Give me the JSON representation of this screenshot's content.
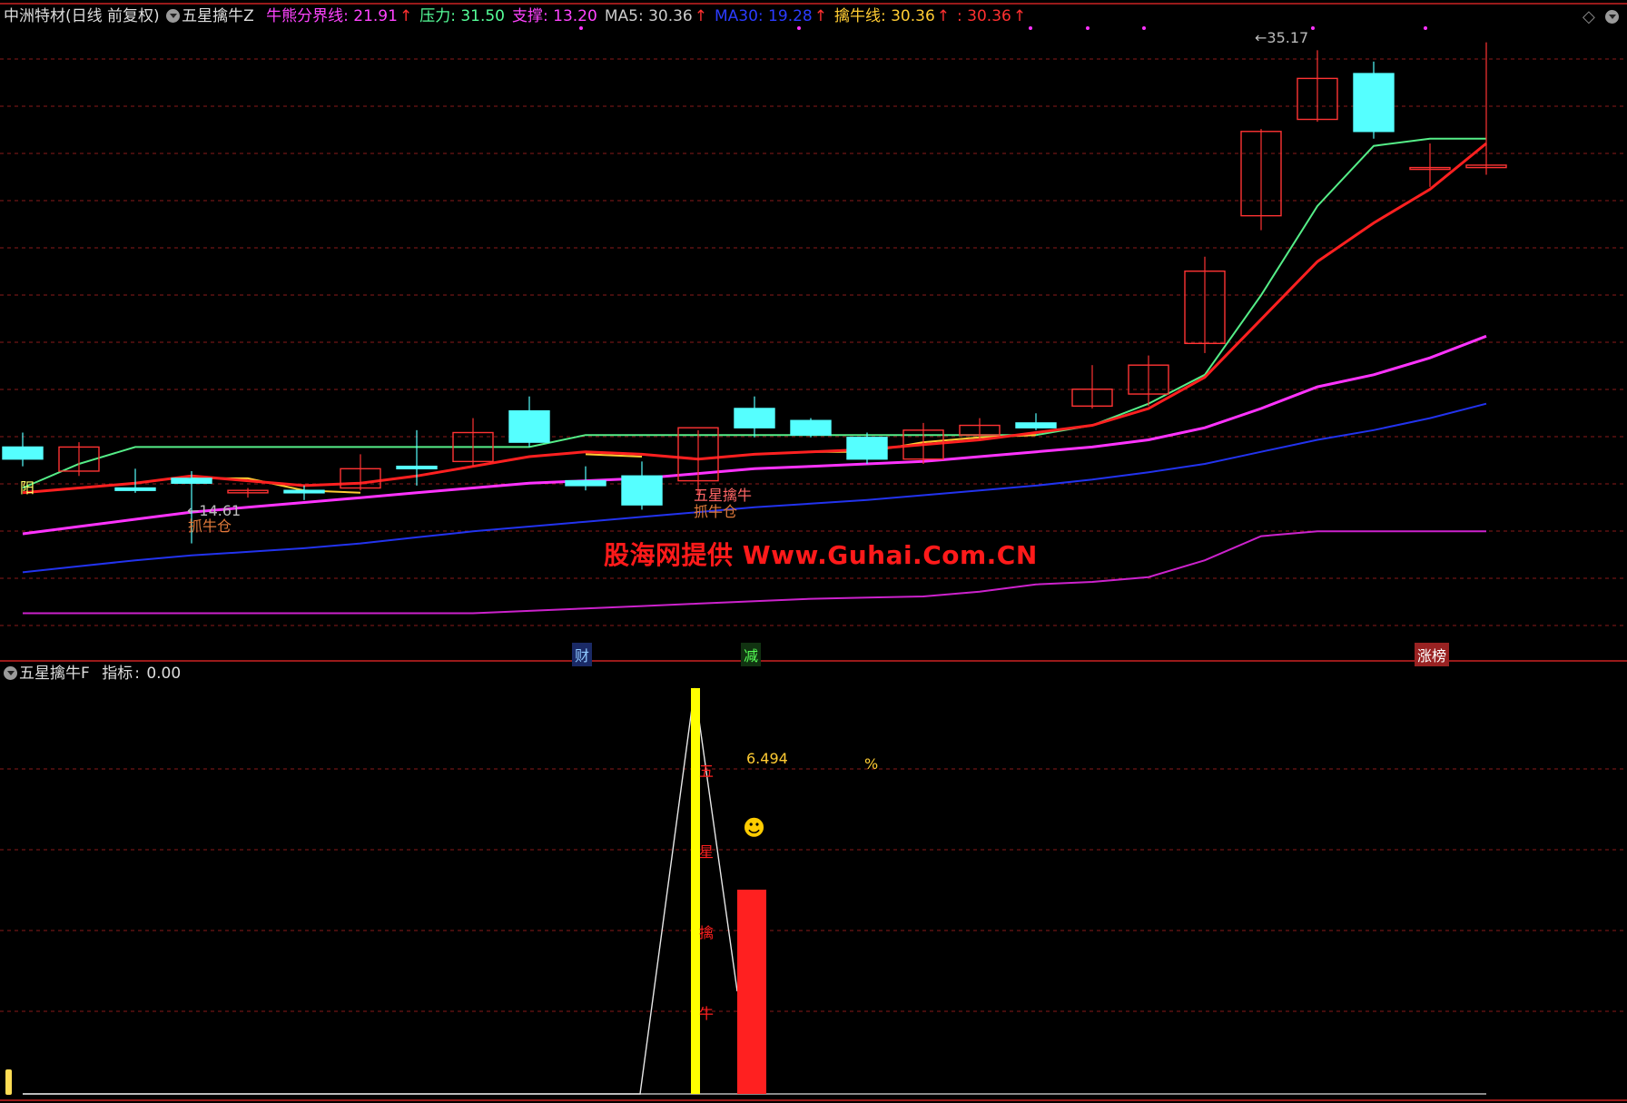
{
  "header": {
    "stock": "中洲特材(日线 前复权)",
    "indicator": "五星擒牛Z",
    "items": [
      {
        "label": "牛熊分界线",
        "value": "21.91",
        "color": "#ff44ff",
        "arrow": true
      },
      {
        "label": "压力",
        "value": "31.50",
        "color": "#55ff99",
        "arrow": false
      },
      {
        "label": "支撑",
        "value": "13.20",
        "color": "#ff44ff",
        "arrow": false
      },
      {
        "label": "MA5",
        "value": "30.36",
        "color": "#cccccc",
        "arrow": true
      },
      {
        "label": "MA30",
        "value": "19.28",
        "color": "#2b3cff",
        "arrow": true
      },
      {
        "label": "擒牛线",
        "value": "30.36",
        "color": "#ffcc33",
        "arrow": true
      },
      {
        "label": "",
        "value": "30.36",
        "color": "#ff3030",
        "arrow": true
      }
    ]
  },
  "sub_header": {
    "indicator": "五星擒牛F",
    "label": "指标",
    "value": "0.00"
  },
  "watermark": "股海网提供 Www.Guhai.Com.CN",
  "bottom_tags": [
    {
      "text": "财",
      "color": "#8fc8ff",
      "bg": "#1a2a66"
    },
    {
      "text": "减",
      "color": "#55ff55",
      "bg": "#113311"
    },
    {
      "text": "涨榜",
      "color": "#ffffff",
      "bg": "#992222"
    }
  ],
  "annotations": {
    "low": "←14.61",
    "high": "←35.17",
    "yang": "阳",
    "grab1": "抓牛仓",
    "grab2": "抓牛仓",
    "wuxing": "五星擒牛",
    "pct_value": "6.494",
    "pct_sign": "%",
    "vert_chars": [
      "五",
      "星",
      "擒",
      "牛"
    ],
    "smiley": "☻"
  },
  "colors": {
    "up": "#ff3333",
    "down": "#55ffff",
    "grid": "#8a1a1a",
    "divider": "#cc2222",
    "green": "#55ee88",
    "red": "#ff2020",
    "magenta": "#ff33ff",
    "blue": "#2233ee",
    "purple": "#cc22cc",
    "yellow": "#ffff00",
    "amber": "#ffcc33"
  },
  "chart_data": [
    {
      "type": "candlestick",
      "price_range": [
        10.2,
        36.2
      ],
      "ohlc": [
        {
          "o": 18.7,
          "h": 19.3,
          "c": 18.2,
          "l": 17.9
        },
        {
          "o": 17.7,
          "h": 18.9,
          "c": 18.7,
          "l": 17.5
        },
        {
          "o": 17.0,
          "h": 17.8,
          "c": 16.9,
          "l": 16.8
        },
        {
          "o": 17.4,
          "h": 17.7,
          "c": 17.2,
          "l": 14.7
        },
        {
          "o": 16.8,
          "h": 17.0,
          "c": 16.9,
          "l": 16.6
        },
        {
          "o": 16.9,
          "h": 17.1,
          "c": 16.8,
          "l": 16.5
        },
        {
          "o": 17.0,
          "h": 18.4,
          "c": 17.8,
          "l": 16.9
        },
        {
          "o": 17.9,
          "h": 19.4,
          "c": 17.8,
          "l": 17.1
        },
        {
          "o": 18.1,
          "h": 19.9,
          "c": 19.3,
          "l": 17.9
        },
        {
          "o": 20.2,
          "h": 20.8,
          "c": 18.9,
          "l": 18.7
        },
        {
          "o": 17.3,
          "h": 17.9,
          "c": 17.1,
          "l": 16.9
        },
        {
          "o": 17.5,
          "h": 18.1,
          "c": 16.3,
          "l": 16.1
        },
        {
          "o": 17.3,
          "h": 19.4,
          "c": 19.5,
          "l": 16.7
        },
        {
          "o": 20.3,
          "h": 20.8,
          "c": 19.5,
          "l": 19.1
        },
        {
          "o": 19.8,
          "h": 19.9,
          "c": 19.2,
          "l": 19.1
        },
        {
          "o": 19.1,
          "h": 19.3,
          "c": 18.2,
          "l": 18.0
        },
        {
          "o": 18.2,
          "h": 19.7,
          "c": 19.4,
          "l": 18.0
        },
        {
          "o": 19.2,
          "h": 19.9,
          "c": 19.6,
          "l": 19.0
        },
        {
          "o": 19.7,
          "h": 20.1,
          "c": 19.5,
          "l": 19.4
        },
        {
          "o": 20.4,
          "h": 22.1,
          "c": 21.1,
          "l": 20.3
        },
        {
          "o": 20.9,
          "h": 22.5,
          "c": 22.1,
          "l": 20.4
        },
        {
          "o": 23.0,
          "h": 26.6,
          "c": 26.0,
          "l": 22.6
        },
        {
          "o": 28.3,
          "h": 31.9,
          "c": 31.8,
          "l": 27.7
        },
        {
          "o": 32.3,
          "h": 35.17,
          "c": 34.0,
          "l": 32.2
        },
        {
          "o": 34.2,
          "h": 34.7,
          "c": 31.8,
          "l": 31.5
        },
        {
          "o": 30.3,
          "h": 31.3,
          "c": 30.3,
          "l": 29.5
        },
        {
          "o": 30.3,
          "h": 35.5,
          "c": 30.4,
          "l": 30.0
        }
      ],
      "lines": [
        {
          "name": "压力",
          "color": "green",
          "values": [
            17.0,
            18.0,
            18.7,
            18.7,
            18.7,
            18.7,
            18.7,
            18.7,
            18.7,
            18.7,
            19.2,
            19.2,
            19.2,
            19.2,
            19.2,
            19.2,
            19.2,
            19.2,
            19.2,
            19.6,
            20.5,
            21.7,
            25.0,
            28.7,
            31.2,
            31.5,
            31.5
          ]
        },
        {
          "name": "擒牛线",
          "color": "amber",
          "values": [
            null,
            null,
            null,
            17.4,
            17.4,
            16.9,
            16.8,
            null,
            null,
            null,
            18.4,
            18.3,
            null,
            null,
            18.5,
            18.5,
            18.9,
            19.1,
            19.2,
            null,
            null,
            null,
            null,
            null,
            null,
            null,
            null
          ]
        },
        {
          "name": "MA5",
          "color": "red",
          "values": [
            16.8,
            17.0,
            17.2,
            17.5,
            17.3,
            17.1,
            17.2,
            17.5,
            17.9,
            18.3,
            18.5,
            18.4,
            18.2,
            18.4,
            18.5,
            18.6,
            18.8,
            19.0,
            19.3,
            19.6,
            20.3,
            21.6,
            24.0,
            26.4,
            28.0,
            29.4,
            31.3
          ]
        },
        {
          "name": "牛熊分界线",
          "color": "magenta",
          "values": [
            15.1,
            15.4,
            15.7,
            16.0,
            16.2,
            16.4,
            16.6,
            16.8,
            17.0,
            17.2,
            17.3,
            17.4,
            17.6,
            17.8,
            17.9,
            18.0,
            18.1,
            18.3,
            18.5,
            18.7,
            19.0,
            19.5,
            20.3,
            21.2,
            21.7,
            22.4,
            23.3
          ]
        },
        {
          "name": "MA30",
          "color": "blue",
          "values": [
            13.5,
            13.75,
            14.0,
            14.2,
            14.35,
            14.5,
            14.7,
            14.95,
            15.2,
            15.4,
            15.6,
            15.8,
            16.0,
            16.2,
            16.35,
            16.5,
            16.7,
            16.9,
            17.1,
            17.35,
            17.65,
            18.0,
            18.5,
            19.0,
            19.4,
            19.9,
            20.5
          ]
        },
        {
          "name": "支撑",
          "color": "purple",
          "values": [
            11.8,
            11.8,
            11.8,
            11.8,
            11.8,
            11.8,
            11.8,
            11.8,
            11.8,
            11.9,
            12.0,
            12.1,
            12.2,
            12.3,
            12.4,
            12.45,
            12.5,
            12.7,
            13.0,
            13.1,
            13.3,
            14.0,
            15.0,
            15.2,
            15.2,
            15.2,
            15.2
          ]
        }
      ]
    },
    {
      "type": "bar",
      "indicator": "五星擒牛F",
      "bars": [
        {
          "index": 12,
          "value": 1.0,
          "color": "yellow"
        },
        {
          "index": 13,
          "value": 0.5,
          "color": "red"
        }
      ],
      "line_values": [
        0,
        0,
        0,
        0,
        0,
        0,
        0,
        0,
        0,
        0,
        0,
        0.0,
        1.0,
        0.25,
        0,
        0,
        0,
        0,
        0,
        0,
        0,
        0,
        0,
        0,
        0,
        0,
        0
      ]
    }
  ]
}
